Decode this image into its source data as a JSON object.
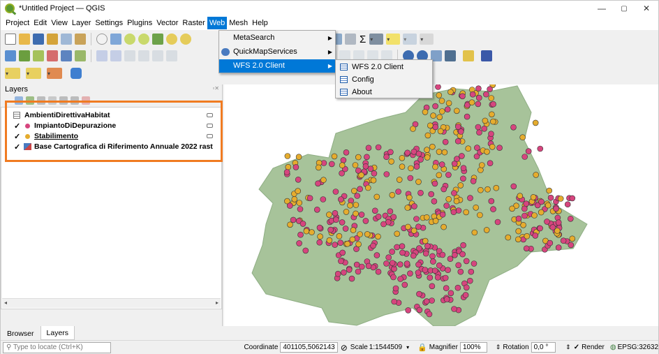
{
  "window": {
    "title": "*Untitled Project — QGIS",
    "minimize": "—",
    "maximize": "▢",
    "close": "✕"
  },
  "menubar": [
    "Project",
    "Edit",
    "View",
    "Layer",
    "Settings",
    "Plugins",
    "Vector",
    "Raster",
    "Web",
    "Mesh",
    "Help"
  ],
  "web_menu": {
    "items": [
      {
        "label": "MetaSearch",
        "has_submenu": true
      },
      {
        "label": "QuickMapServices",
        "has_submenu": true
      },
      {
        "label": "WFS 2.0 Client",
        "has_submenu": true
      }
    ],
    "wfs_submenu": [
      "WFS 2.0 Client",
      "Config",
      "About"
    ]
  },
  "layers_panel": {
    "title": "Layers",
    "layers": [
      {
        "name": "AmbientiDirettivaHabitat",
        "checked": false,
        "kind": "table"
      },
      {
        "name": "ImpiantoDiDepurazione",
        "checked": true,
        "kind": "point",
        "color": "#d6457e"
      },
      {
        "name": "Stabilimento",
        "checked": true,
        "kind": "point",
        "color": "#e5ac2e"
      },
      {
        "name": "Base Cartografica di Riferimento Annuale 2022 rast",
        "checked": true,
        "kind": "raster"
      }
    ]
  },
  "bottom_tabs": [
    "Browser",
    "Layers"
  ],
  "statusbar": {
    "locate_placeholder": "Type to locate (Ctrl+K)",
    "coordinate_label": "Coordinate",
    "coordinate_value": "401105,5062143",
    "scale_label": "Scale",
    "scale_value": "1:1544509",
    "magnifier_label": "Magnifier",
    "magnifier_value": "100%",
    "rotation_label": "Rotation",
    "rotation_value": "0,0 °",
    "render_label": "Render",
    "crs": "EPSG:32632"
  },
  "colors": {
    "impianto": "#d6457e",
    "stabilimento": "#e5ac2e",
    "highlight": "#f07b21",
    "menu_highlight": "#0078d7"
  }
}
